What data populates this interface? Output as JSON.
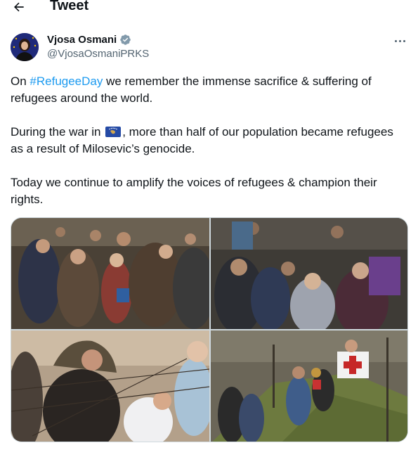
{
  "header": {
    "title": "Tweet",
    "back_icon": "arrow-left-icon"
  },
  "author": {
    "display_name": "Vjosa Osmani",
    "handle": "@VjosaOsmaniPRKS",
    "verified_icon": "verified-badge-icon",
    "more_icon": "more-options-icon"
  },
  "tweet": {
    "p1_before": "On ",
    "hashtag": "#RefugeeDay",
    "p1_after": " we remember the immense sacrifice & suffering of refugees around the world.",
    "p2_before": "During the war in ",
    "flag_icon": "kosovo-flag-icon",
    "p2_after": ", more than half of our population became refugees as a result of Milosevic’s genocide.",
    "p3": "Today we continue to amplify the voices of refugees & champion their rights."
  },
  "colors": {
    "accent": "#1d9bf0",
    "text": "#0f1419",
    "secondary_text": "#536471",
    "border": "#cfd9de"
  }
}
